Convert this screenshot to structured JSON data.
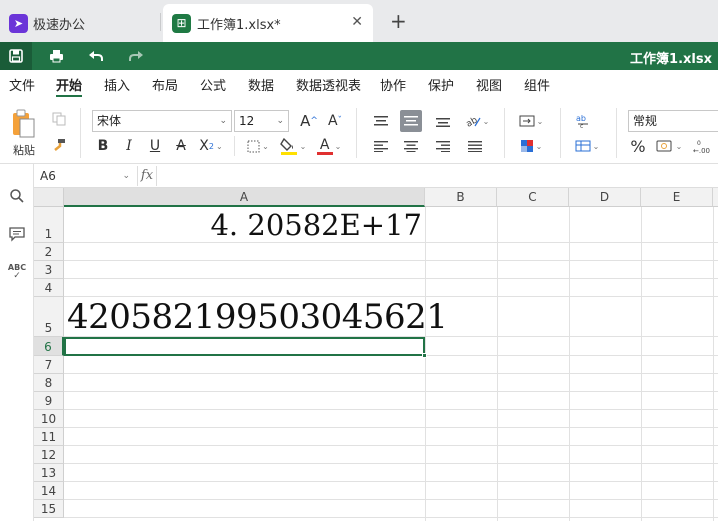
{
  "tabs": [
    {
      "label": "极速办公",
      "icon": "rocket-icon"
    },
    {
      "label": "工作簿1.xlsx*",
      "icon": "spreadsheet-icon"
    }
  ],
  "quick_toolbar": {
    "doc_title": "工作簿1.xlsx"
  },
  "menu": {
    "items": [
      "文件",
      "开始",
      "插入",
      "布局",
      "公式",
      "数据",
      "数据透视表",
      "协作",
      "保护",
      "视图",
      "组件"
    ],
    "active": "开始"
  },
  "ribbon": {
    "paste_label": "粘贴",
    "font_name": "宋体",
    "font_size": "12",
    "number_format": "常规",
    "grow_font": "A",
    "shrink_font": "A",
    "bold": "B",
    "italic": "I",
    "underline": "U",
    "strike": "A",
    "subscript": "X",
    "font_color_letter": "A",
    "percent": "%",
    "colors": {
      "fill_highlight": "#ffe000",
      "font_color": "#e03030",
      "accent": "#217346"
    }
  },
  "formula_bar": {
    "cell_ref": "A6",
    "fx": "fx",
    "content": ""
  },
  "sheet": {
    "columns": [
      "A",
      "B",
      "C",
      "D",
      "E"
    ],
    "selected_column": "A",
    "rows": [
      "1",
      "2",
      "3",
      "4",
      "5",
      "6",
      "7",
      "8",
      "9",
      "10",
      "11",
      "12",
      "13",
      "14",
      "15"
    ],
    "selected_row": "6",
    "cells": {
      "A1": "4. 20582E+17",
      "A5": "420582199503045621"
    }
  },
  "sidebar": {
    "icons": [
      "search-icon",
      "comment-icon",
      "spellcheck-icon"
    ],
    "spellcheck_label": "ABC"
  }
}
